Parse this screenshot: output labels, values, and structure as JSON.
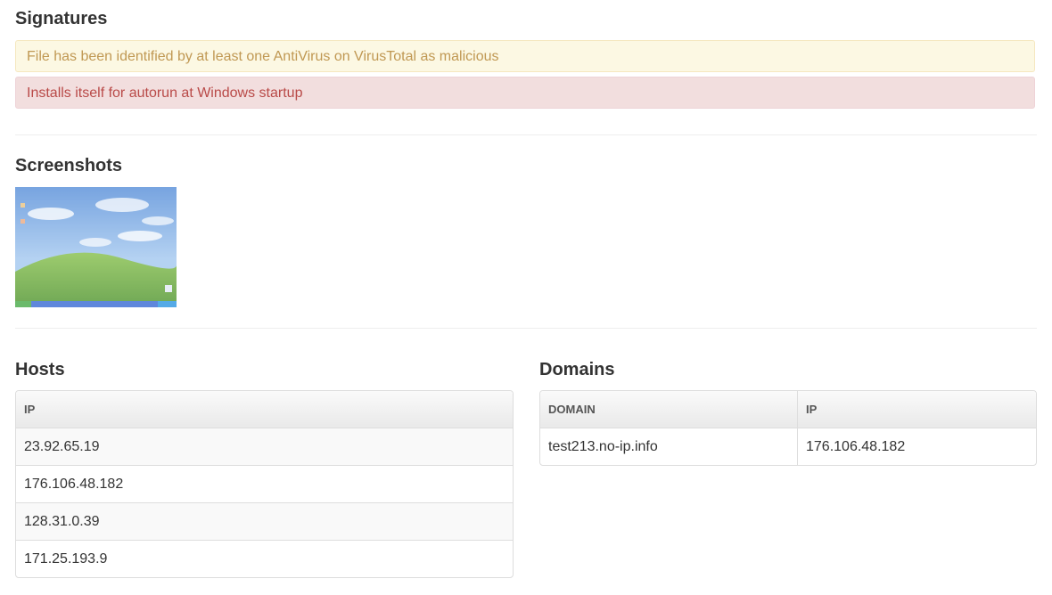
{
  "signatures": {
    "title": "Signatures",
    "alerts": [
      {
        "level": "warning",
        "text": "File has been identified by at least one AntiVirus on VirusTotal as malicious"
      },
      {
        "level": "danger",
        "text": "Installs itself for autorun at Windows startup"
      }
    ]
  },
  "screenshots": {
    "title": "Screenshots"
  },
  "hosts": {
    "title": "Hosts",
    "column": "IP",
    "rows": [
      "23.92.65.19",
      "176.106.48.182",
      "128.31.0.39",
      "171.25.193.9"
    ]
  },
  "domains": {
    "title": "Domains",
    "columns": [
      "DOMAIN",
      "IP"
    ],
    "rows": [
      {
        "domain": "test213.no-ip.info",
        "ip": "176.106.48.182"
      }
    ]
  },
  "colors": {
    "warning_bg": "#fcf8e3",
    "warning_text": "#c09853",
    "danger_bg": "#f2dede",
    "danger_text": "#b94a48"
  }
}
